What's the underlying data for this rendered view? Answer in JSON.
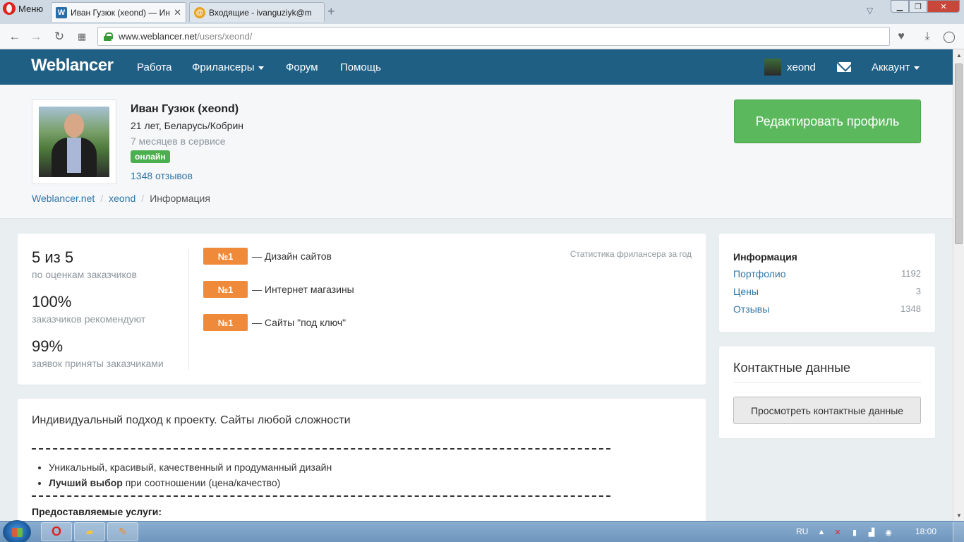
{
  "browser": {
    "menu_label": "Меню",
    "tabs": [
      {
        "title": "Иван Гузюк (xeond) — Ин",
        "favicon": "weblancer-favicon"
      },
      {
        "title": "Входящие - ivanguziyk@m",
        "favicon": "mail-favicon"
      }
    ],
    "url_host": "www.weblancer.net",
    "url_path": "/users/xeond/"
  },
  "site": {
    "logo": "Weblancer",
    "nav": [
      {
        "label": "Работа"
      },
      {
        "label": "Фрилансеры"
      },
      {
        "label": "Форум"
      },
      {
        "label": "Помощь"
      }
    ],
    "user_name": "xeond",
    "account_label": "Аккаунт"
  },
  "profile": {
    "name": "Иван Гузюк (xeond)",
    "info": "21 лет, Беларусь/Кобрин",
    "since": "7 месяцев в сервисе",
    "status": "онлайн",
    "reviews": "1348 отзывов",
    "edit_button": "Редактировать профиль"
  },
  "breadcrumbs": [
    "Weblancer.net",
    "xeond",
    "Информация"
  ],
  "stats": {
    "items": [
      {
        "value": "5 из 5",
        "label": "по оценкам заказчиков"
      },
      {
        "value": "100%",
        "label": "заказчиков рекомендуют"
      },
      {
        "value": "99%",
        "label": "заявок приняты заказчиками"
      }
    ],
    "note": "Статистика фрилансера за год",
    "ranks": [
      {
        "badge": "№1",
        "text": "— Дизайн сайтов"
      },
      {
        "badge": "№1",
        "text": "— Интернет магазины"
      },
      {
        "badge": "№1",
        "text": "— Сайты \"под ключ\""
      }
    ]
  },
  "info_panel": {
    "title": "Информация",
    "rows": [
      {
        "label": "Портфолио",
        "count": "1192"
      },
      {
        "label": "Цены",
        "count": "3"
      },
      {
        "label": "Отзывы",
        "count": "1348"
      }
    ]
  },
  "contact_panel": {
    "title": "Контактные данные",
    "button": "Просмотреть контактные данные"
  },
  "about": {
    "title": "Индивидуальный подход к проекту. Сайты любой сложности",
    "bullet1": "Уникальный, красивый, качественный и продуманный дизайн",
    "bullet2_bold": "Лучший выбор",
    "bullet2_rest": " при соотношении (цена/качество)",
    "subheading": "Предоставляемые услуги:"
  },
  "taskbar": {
    "lang": "RU",
    "clock": "18:00"
  },
  "colors": {
    "nav_bg": "#1f5f84",
    "link": "#2f77a8",
    "success": "#5cb85c",
    "badge_online": "#4bae4f",
    "rank_badge": "#ef8a3a"
  }
}
